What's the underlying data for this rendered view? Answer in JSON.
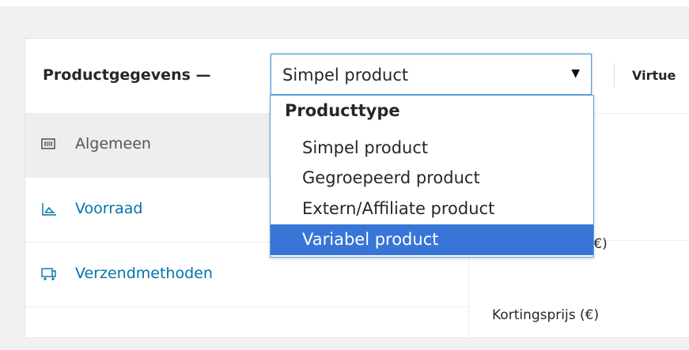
{
  "header": {
    "title": "Productgegevens —",
    "product_type_select": {
      "value": "Simpel product",
      "arrow_icon": "▼"
    },
    "virtual_label": "Virtue"
  },
  "dropdown": {
    "group_label": "Producttype",
    "options": [
      {
        "label": "Simpel product",
        "selected": false
      },
      {
        "label": "Gegroepeerd product",
        "selected": false
      },
      {
        "label": "Extern/Affiliate product",
        "selected": false
      },
      {
        "label": "Variabel product",
        "selected": true
      }
    ]
  },
  "sidebar": {
    "tabs": [
      {
        "label": "Algemeen",
        "icon": "general-icon",
        "active": true
      },
      {
        "label": "Voorraad",
        "icon": "inventory-icon",
        "active": false
      },
      {
        "label": "Verzendmethoden",
        "icon": "shipping-icon",
        "active": false
      }
    ]
  },
  "content": {
    "regular_price_label_partial": "ijs (€)",
    "sale_price_label_partial": "Kortingsprijs (€)"
  },
  "colors": {
    "accent": "#5b9dd9",
    "selected_option_bg": "#3875d7",
    "link": "#0073aa",
    "active_tab_bg": "#eeeeee"
  }
}
